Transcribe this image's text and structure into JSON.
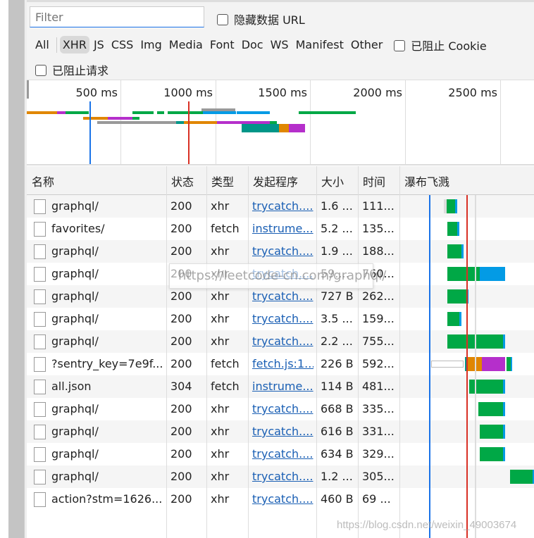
{
  "toolbar": {
    "filter_placeholder": "Filter",
    "hide_data_url": "隐藏数据 URL",
    "types": [
      "All",
      "XHR",
      "JS",
      "CSS",
      "Img",
      "Media",
      "Font",
      "Doc",
      "WS",
      "Manifest",
      "Other"
    ],
    "selected_type": "XHR",
    "blocked_cookies": "已阻止 Cookie",
    "blocked_requests": "已阻止请求"
  },
  "overview": {
    "ticks": [
      "500 ms",
      "1000 ms",
      "1500 ms",
      "2000 ms",
      "2500 ms"
    ]
  },
  "table": {
    "headers": [
      "名称",
      "状态",
      "类型",
      "发起程序",
      "大小",
      "时间",
      "瀑布飞溅"
    ],
    "rows": [
      [
        "graphql/",
        "200",
        "xhr",
        "trycatch....",
        "1.6 ...",
        "111..."
      ],
      [
        "favorites/",
        "200",
        "fetch",
        "instrume...",
        "5.2 ...",
        "135..."
      ],
      [
        "graphql/",
        "200",
        "xhr",
        "trycatch....",
        "1.9 ...",
        "188..."
      ],
      [
        "graphql/",
        "200",
        "xhr",
        "trycatch....",
        "59....",
        "760..."
      ],
      [
        "graphql/",
        "200",
        "xhr",
        "trycatch....",
        "727 B",
        "262..."
      ],
      [
        "graphql/",
        "200",
        "xhr",
        "trycatch....",
        "3.5 ...",
        "159..."
      ],
      [
        "graphql/",
        "200",
        "xhr",
        "trycatch....",
        "2.2 ...",
        "755..."
      ],
      [
        "?sentry_key=7e9f...",
        "200",
        "fetch",
        "fetch.js:1...",
        "226 B",
        "592..."
      ],
      [
        "all.json",
        "304",
        "fetch",
        "instrume...",
        "114 B",
        "481..."
      ],
      [
        "graphql/",
        "200",
        "xhr",
        "trycatch....",
        "668 B",
        "335..."
      ],
      [
        "graphql/",
        "200",
        "xhr",
        "trycatch....",
        "616 B",
        "331..."
      ],
      [
        "graphql/",
        "200",
        "xhr",
        "trycatch....",
        "634 B",
        "329..."
      ],
      [
        "graphql/",
        "200",
        "xhr",
        "trycatch....",
        "1.2 ...",
        "305..."
      ],
      [
        "action?stm=1626...",
        "200",
        "xhr",
        "trycatch....",
        "460 B",
        "69 ..."
      ]
    ]
  },
  "tooltip": "https://leetcode-cn.com/graphql/",
  "watermark": "https://blog.csdn.net/weixin_49003674",
  "colors": {
    "waiting": "#00a846",
    "download": "#039be5",
    "dns": "#009688",
    "connect": "#e08600",
    "ssl": "#b52fcb",
    "dcl": "#1a73e8",
    "load": "#d93025"
  }
}
